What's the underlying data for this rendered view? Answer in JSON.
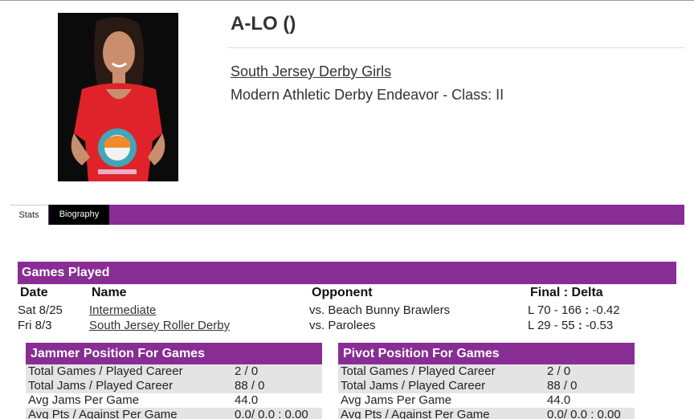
{
  "skater": {
    "name": "A-LO ()",
    "team": "South Jersey Derby Girls",
    "class_line": "Modern Athletic Derby Endeavor - Class: II"
  },
  "tabs": [
    {
      "label": "Stats",
      "active": true
    },
    {
      "label": "Biography",
      "active": false
    }
  ],
  "games": {
    "title": "Games Played",
    "columns": [
      "Date",
      "Name",
      "Opponent",
      "Final : Delta"
    ],
    "rows": [
      {
        "date": "Sat 8/25",
        "name": "Intermediate",
        "opponent": "vs. Beach Bunny Brawlers",
        "final": "L 70 - 166",
        "sep": ":",
        "delta": "-0.42"
      },
      {
        "date": "Fri 8/3",
        "name": "South Jersey Roller Derby",
        "opponent": "vs. Parolees",
        "final": "L 29 - 55",
        "sep": ":",
        "delta": "-0.53"
      }
    ]
  },
  "jammer": {
    "title": "Jammer Position For Games",
    "rows": [
      {
        "label": "Total Games / Played Career",
        "value": "2 / 0"
      },
      {
        "label": "Total Jams / Played Career",
        "value": "88 / 0"
      },
      {
        "label": "Avg Jams Per Game",
        "value": "44.0"
      },
      {
        "label": "Avg Pts / Against Per Game",
        "value": "0.0/ 0.0 : 0.00"
      }
    ]
  },
  "pivot": {
    "title": "Pivot Position For Games",
    "rows": [
      {
        "label": "Total Games / Played Career",
        "value": "2 / 0"
      },
      {
        "label": "Total Jams / Played Career",
        "value": "88 / 0"
      },
      {
        "label": "Avg Jams Per Game",
        "value": "44.0"
      },
      {
        "label": "Avg Pts / Against Per Game",
        "value": "0.0/ 0.0 : 0.00"
      }
    ]
  },
  "colors": {
    "accent": "#882d93",
    "row_alt": "#e4e4e4"
  },
  "icons": {
    "photo": "skater-photo"
  }
}
